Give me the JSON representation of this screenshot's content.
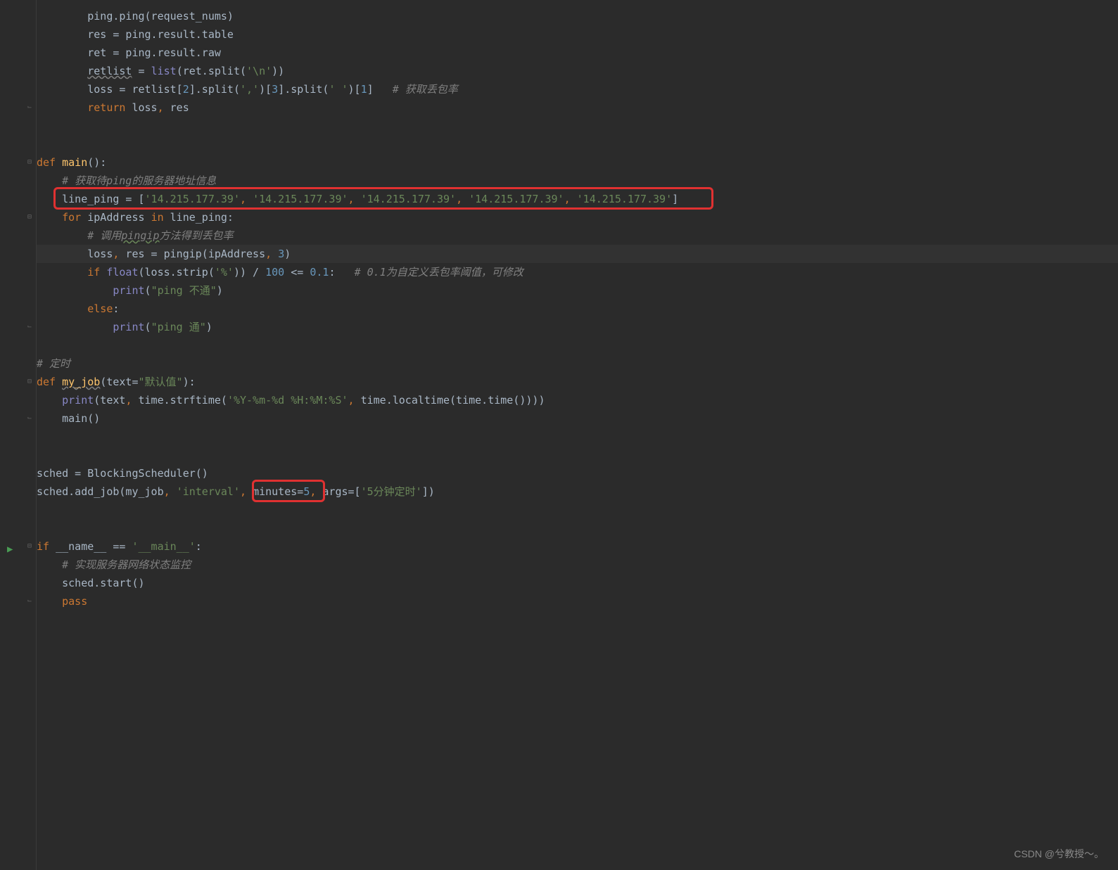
{
  "code_lines": [
    {
      "indent": 2,
      "tokens": [
        {
          "t": "ping.ping(request_nums)",
          "c": ""
        }
      ]
    },
    {
      "indent": 2,
      "tokens": [
        {
          "t": "res = ping.result.table",
          "c": ""
        }
      ]
    },
    {
      "indent": 2,
      "tokens": [
        {
          "t": "ret = ping.result.raw",
          "c": ""
        }
      ]
    },
    {
      "indent": 2,
      "tokens": [
        {
          "t": "retlist",
          "c": "underline"
        },
        {
          "t": " = ",
          "c": ""
        },
        {
          "t": "list",
          "c": "builtin"
        },
        {
          "t": "(ret.split(",
          "c": ""
        },
        {
          "t": "'\\n'",
          "c": "str"
        },
        {
          "t": "))",
          "c": ""
        }
      ]
    },
    {
      "indent": 2,
      "tokens": [
        {
          "t": "loss = retlist[",
          "c": ""
        },
        {
          "t": "2",
          "c": "num"
        },
        {
          "t": "].split(",
          "c": ""
        },
        {
          "t": "','",
          "c": "str"
        },
        {
          "t": ")[",
          "c": ""
        },
        {
          "t": "3",
          "c": "num"
        },
        {
          "t": "].split(",
          "c": ""
        },
        {
          "t": "' '",
          "c": "str"
        },
        {
          "t": ")[",
          "c": ""
        },
        {
          "t": "1",
          "c": "num"
        },
        {
          "t": "]   ",
          "c": ""
        },
        {
          "t": "# 获取丢包率",
          "c": "cmt"
        }
      ]
    },
    {
      "indent": 2,
      "tokens": [
        {
          "t": "return ",
          "c": "kw"
        },
        {
          "t": "loss",
          "c": ""
        },
        {
          "t": ", ",
          "c": "kw"
        },
        {
          "t": "res",
          "c": ""
        }
      ],
      "fold_end": true
    },
    {
      "indent": 0,
      "tokens": []
    },
    {
      "indent": 0,
      "tokens": []
    },
    {
      "indent": 0,
      "tokens": [
        {
          "t": "def ",
          "c": "kw"
        },
        {
          "t": "main",
          "c": "fn"
        },
        {
          "t": "():",
          "c": ""
        }
      ],
      "fold_start": true
    },
    {
      "indent": 1,
      "tokens": [
        {
          "t": "# 获取待ping的服务器地址信息",
          "c": "cmt"
        }
      ]
    },
    {
      "indent": 1,
      "tokens": [
        {
          "t": "line_ping = [",
          "c": ""
        },
        {
          "t": "'14.215.177.39'",
          "c": "str"
        },
        {
          "t": ", ",
          "c": "kw"
        },
        {
          "t": "'14.215.177.39'",
          "c": "str"
        },
        {
          "t": ", ",
          "c": "kw"
        },
        {
          "t": "'14.215.177.39'",
          "c": "str"
        },
        {
          "t": ", ",
          "c": "kw"
        },
        {
          "t": "'14.215.177.39'",
          "c": "str"
        },
        {
          "t": ", ",
          "c": "kw"
        },
        {
          "t": "'14.215.177.39'",
          "c": "str"
        },
        {
          "t": "]",
          "c": ""
        }
      ],
      "redbox": true
    },
    {
      "indent": 1,
      "tokens": [
        {
          "t": "for ",
          "c": "kw"
        },
        {
          "t": "ipAddress ",
          "c": ""
        },
        {
          "t": "in ",
          "c": "kw"
        },
        {
          "t": "line_ping:",
          "c": ""
        }
      ],
      "fold_start": true
    },
    {
      "indent": 2,
      "tokens": [
        {
          "t": "# 调用",
          "c": "cmt"
        },
        {
          "t": "pingip",
          "c": "cmt underline-g"
        },
        {
          "t": "方法得到丢包率",
          "c": "cmt"
        }
      ]
    },
    {
      "indent": 2,
      "tokens": [
        {
          "t": "loss",
          "c": ""
        },
        {
          "t": ", ",
          "c": "kw"
        },
        {
          "t": "res = pingip(ipAddress",
          "c": ""
        },
        {
          "t": ", ",
          "c": "kw"
        },
        {
          "t": "3",
          "c": "num"
        },
        {
          "t": ")",
          "c": ""
        }
      ],
      "highlight": true
    },
    {
      "indent": 2,
      "tokens": [
        {
          "t": "if ",
          "c": "kw"
        },
        {
          "t": "float",
          "c": "builtin"
        },
        {
          "t": "(loss.strip(",
          "c": ""
        },
        {
          "t": "'%'",
          "c": "str"
        },
        {
          "t": ")) / ",
          "c": ""
        },
        {
          "t": "100",
          "c": "num"
        },
        {
          "t": " <= ",
          "c": ""
        },
        {
          "t": "0.1",
          "c": "num"
        },
        {
          "t": ":   ",
          "c": ""
        },
        {
          "t": "# 0.1为自定义丢包率阈值，可修改",
          "c": "cmt"
        }
      ]
    },
    {
      "indent": 3,
      "tokens": [
        {
          "t": "print",
          "c": "builtin"
        },
        {
          "t": "(",
          "c": ""
        },
        {
          "t": "\"ping 不通\"",
          "c": "str"
        },
        {
          "t": ")",
          "c": ""
        }
      ]
    },
    {
      "indent": 2,
      "tokens": [
        {
          "t": "else",
          "c": "kw"
        },
        {
          "t": ":",
          "c": ""
        }
      ]
    },
    {
      "indent": 3,
      "tokens": [
        {
          "t": "print",
          "c": "builtin"
        },
        {
          "t": "(",
          "c": ""
        },
        {
          "t": "\"ping 通\"",
          "c": "str"
        },
        {
          "t": ")",
          "c": ""
        }
      ],
      "fold_end": true
    },
    {
      "indent": 0,
      "tokens": []
    },
    {
      "indent": 0,
      "tokens": [
        {
          "t": "# 定时",
          "c": "cmt"
        }
      ]
    },
    {
      "indent": 0,
      "tokens": [
        {
          "t": "def ",
          "c": "kw"
        },
        {
          "t": "my_job",
          "c": "fn underline"
        },
        {
          "t": "(",
          "c": ""
        },
        {
          "t": "text",
          "c": "param"
        },
        {
          "t": "=",
          "c": ""
        },
        {
          "t": "\"默认值\"",
          "c": "str"
        },
        {
          "t": "):",
          "c": ""
        }
      ],
      "fold_start": true
    },
    {
      "indent": 1,
      "tokens": [
        {
          "t": "print",
          "c": "builtin"
        },
        {
          "t": "(text",
          "c": ""
        },
        {
          "t": ", ",
          "c": "kw"
        },
        {
          "t": "time.strftime(",
          "c": ""
        },
        {
          "t": "'%Y-%m-%d %H:%M:%S'",
          "c": "str"
        },
        {
          "t": ", ",
          "c": "kw"
        },
        {
          "t": "time.localtime(time.time())))",
          "c": ""
        }
      ]
    },
    {
      "indent": 1,
      "tokens": [
        {
          "t": "main()",
          "c": ""
        }
      ],
      "fold_end": true
    },
    {
      "indent": 0,
      "tokens": []
    },
    {
      "indent": 0,
      "tokens": []
    },
    {
      "indent": 0,
      "tokens": [
        {
          "t": "sched = BlockingScheduler()",
          "c": ""
        }
      ]
    },
    {
      "indent": 0,
      "tokens": [
        {
          "t": "sched.add_job(my_job",
          "c": ""
        },
        {
          "t": ", ",
          "c": "kw"
        },
        {
          "t": "'interval'",
          "c": "str"
        },
        {
          "t": ", ",
          "c": "kw"
        },
        {
          "t": "minutes",
          "c": "param",
          "box": true
        },
        {
          "t": "=",
          "c": "",
          "box": true
        },
        {
          "t": "5",
          "c": "num",
          "box": true
        },
        {
          "t": ", ",
          "c": "kw",
          "box": true
        },
        {
          "t": "args",
          "c": "param"
        },
        {
          "t": "=[",
          "c": ""
        },
        {
          "t": "'5分钟定时'",
          "c": "str"
        },
        {
          "t": "])",
          "c": ""
        }
      ]
    },
    {
      "indent": 0,
      "tokens": []
    },
    {
      "indent": 0,
      "tokens": []
    },
    {
      "indent": 0,
      "tokens": [
        {
          "t": "if ",
          "c": "kw"
        },
        {
          "t": "__name__ == ",
          "c": ""
        },
        {
          "t": "'__main__'",
          "c": "str"
        },
        {
          "t": ":",
          "c": ""
        }
      ],
      "fold_start": true,
      "run": true
    },
    {
      "indent": 1,
      "tokens": [
        {
          "t": "# 实现服务器网络状态监控",
          "c": "cmt"
        }
      ]
    },
    {
      "indent": 1,
      "tokens": [
        {
          "t": "sched.start()",
          "c": ""
        }
      ]
    },
    {
      "indent": 1,
      "tokens": [
        {
          "t": "pass",
          "c": "kw"
        }
      ],
      "fold_end": true
    },
    {
      "indent": 0,
      "tokens": []
    }
  ],
  "watermark": "CSDN @兮教授～。",
  "indent_unit": "    ",
  "redbox1_line": 10,
  "redbox2_line": 26
}
